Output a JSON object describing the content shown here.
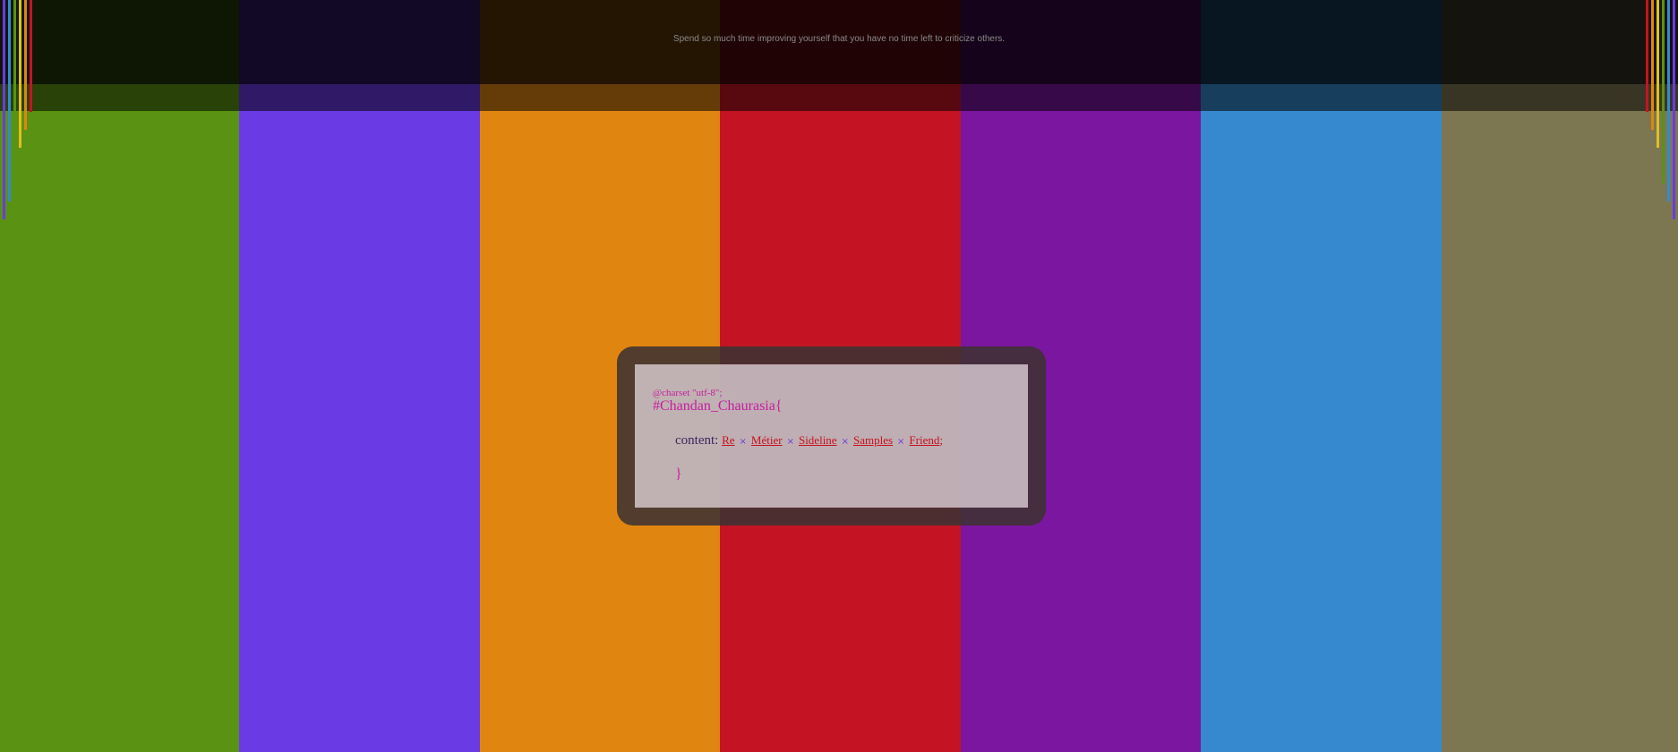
{
  "quote": "Spend so much time improving yourself that you have no time left to criticize others.",
  "code": {
    "charset": "@charset \"utf-8\";",
    "selector": "#Chandan_Chaurasia{",
    "property": "content:",
    "links": [
      "Re",
      "Métier",
      "Sideline",
      "Samples",
      "Friend"
    ],
    "separator": "×",
    "terminator": ";",
    "close_brace": "}"
  },
  "colors": {
    "stripes": [
      "#5a9213",
      "#6a3be4",
      "#e08510",
      "#c41424",
      "#7a169f",
      "#3689cf",
      "#7d7751"
    ],
    "drips": [
      "#6a3be4",
      "#3689cf",
      "#5a9213",
      "#e0c020",
      "#e08510",
      "#c41424"
    ]
  }
}
